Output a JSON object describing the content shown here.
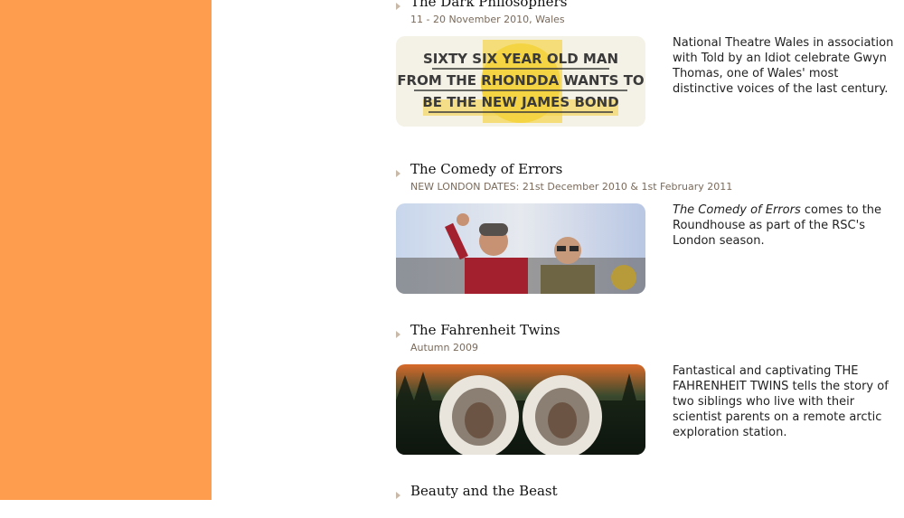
{
  "colors": {
    "sidebar": "#ff9d4f",
    "bullet": "#c9b9a8",
    "date_text": "#7a6a5a"
  },
  "shows": [
    {
      "title": "The Dark Philosophers",
      "date": "11 - 20 November 2010, Wales",
      "image_text": [
        "SIXTY SIX YEAR OLD MAN",
        "FROM THE RHONDDA WANTS TO",
        "BE THE NEW JAMES BOND"
      ],
      "description": "National Theatre Wales in association with Told by an Idiot celebrate Gwyn Thomas, one of Wales' most distinctive voices of the last century."
    },
    {
      "title": "The Comedy of Errors",
      "date": "NEW LONDON DATES: 21st December 2010 & 1st February 2011",
      "description_em": "The Comedy of Errors",
      "description": " comes to the Roundhouse as part of the RSC's London season."
    },
    {
      "title": "The Fahrenheit Twins",
      "date": "Autumn 2009",
      "description": "Fantastical and captivating THE FAHRENHEIT TWINS tells the story of two siblings who live with their scientist parents on a remote arctic exploration station."
    },
    {
      "title": "Beauty and the Beast"
    }
  ]
}
